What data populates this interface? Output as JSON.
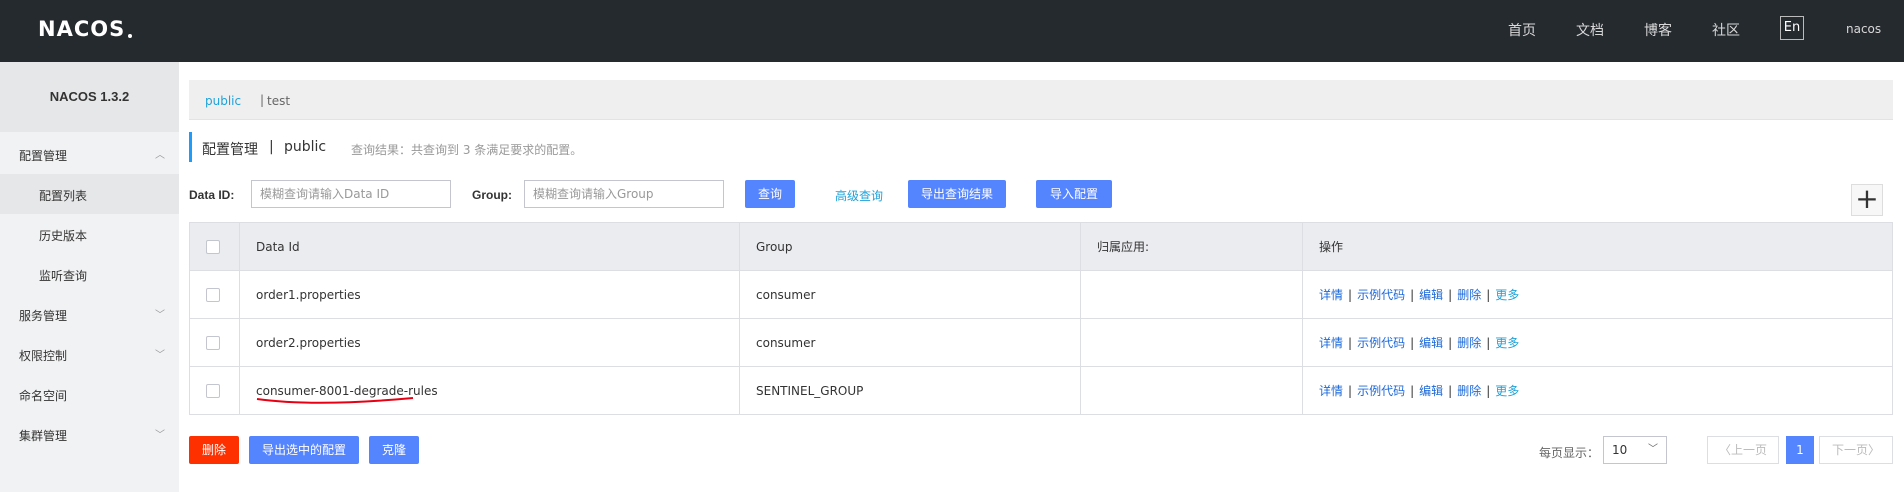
{
  "header": {
    "logo_text": "NACOS",
    "nav": [
      "首页",
      "文档",
      "博客",
      "社区"
    ],
    "lang": "En",
    "user": "nacos"
  },
  "sidebar": {
    "version": "NACOS 1.3.2",
    "items": [
      {
        "label": "配置管理"
      },
      {
        "label": "配置列表"
      },
      {
        "label": "历史版本"
      },
      {
        "label": "监听查询"
      },
      {
        "label": "服务管理"
      },
      {
        "label": "权限控制"
      },
      {
        "label": "命名空间"
      },
      {
        "label": "集群管理"
      }
    ]
  },
  "namespace": {
    "active": "public",
    "separator": "|",
    "other": "test"
  },
  "title": {
    "main": "配置管理",
    "separator": "|",
    "namespace": "public",
    "info": "查询结果：共查询到 3 条满足要求的配置。"
  },
  "filters": {
    "data_id_label": "Data ID:",
    "data_id_placeholder": "模糊查询请输入Data ID",
    "group_label": "Group:",
    "group_placeholder": "模糊查询请输入Group",
    "search_btn": "查询",
    "advanced": "高级查询",
    "export_results": "导出查询结果",
    "import_config": "导入配置",
    "add": "+"
  },
  "table": {
    "headers": [
      "Data Id",
      "Group",
      "归属应用:",
      "操作"
    ],
    "rows": [
      {
        "data_id": "order1.properties",
        "group": "consumer",
        "app": ""
      },
      {
        "data_id": "order2.properties",
        "group": "consumer",
        "app": ""
      },
      {
        "data_id": "consumer-8001-degrade-rules",
        "group": "SENTINEL_GROUP",
        "app": ""
      }
    ],
    "ops": {
      "detail": "详情",
      "sample": "示例代码",
      "edit": "编辑",
      "delete": "删除",
      "more": "更多",
      "sep": "|"
    }
  },
  "footer": {
    "delete": "删除",
    "export_selected": "导出选中的配置",
    "clone": "克隆",
    "page_size_label": "每页显示：",
    "page_size": "10",
    "prev": "上一页",
    "current_page": "1",
    "next": "下一页"
  },
  "colors": {
    "primary": "#5584ff",
    "danger": "#ff3000",
    "link": "#1fa2d8",
    "header_bg": "#252a2f"
  }
}
